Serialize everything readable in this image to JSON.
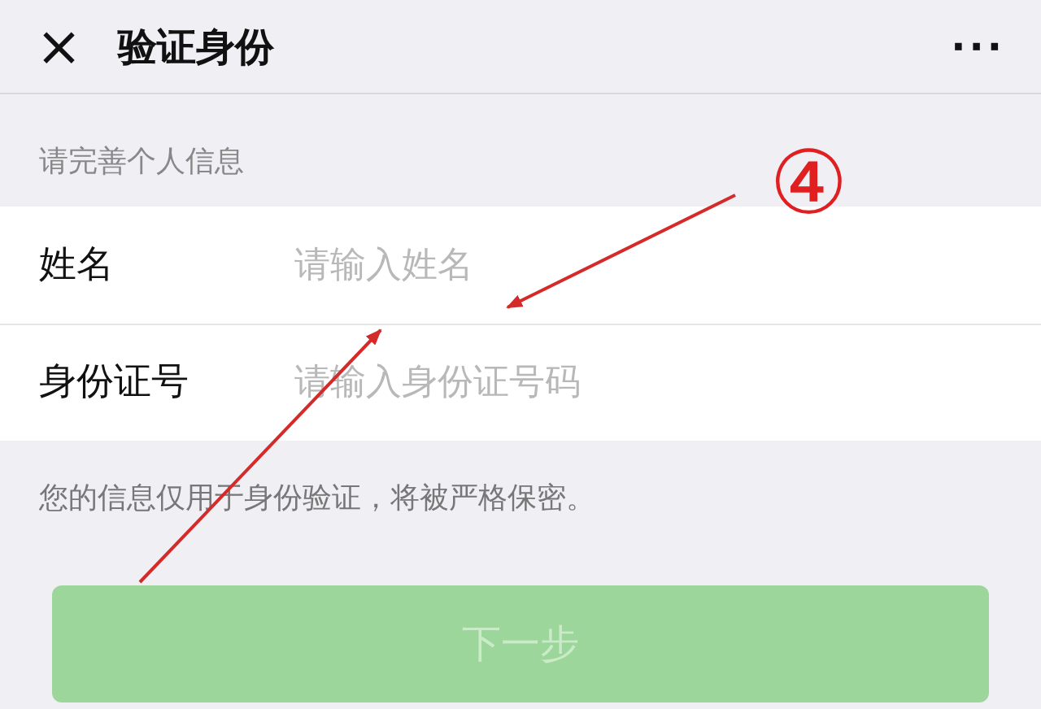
{
  "header": {
    "close_icon": "×",
    "title": "验证身份",
    "more_icon": "···"
  },
  "section_label": "请完善个人信息",
  "fields": [
    {
      "label": "姓名",
      "placeholder": "请输入姓名"
    },
    {
      "label": "身份证号",
      "placeholder": "请输入身份证号码"
    }
  ],
  "note": "您的信息仅用于身份验证，将被严格保密。",
  "next_button": {
    "label": "下一步",
    "disabled": true
  },
  "annotation": {
    "label": "④"
  }
}
